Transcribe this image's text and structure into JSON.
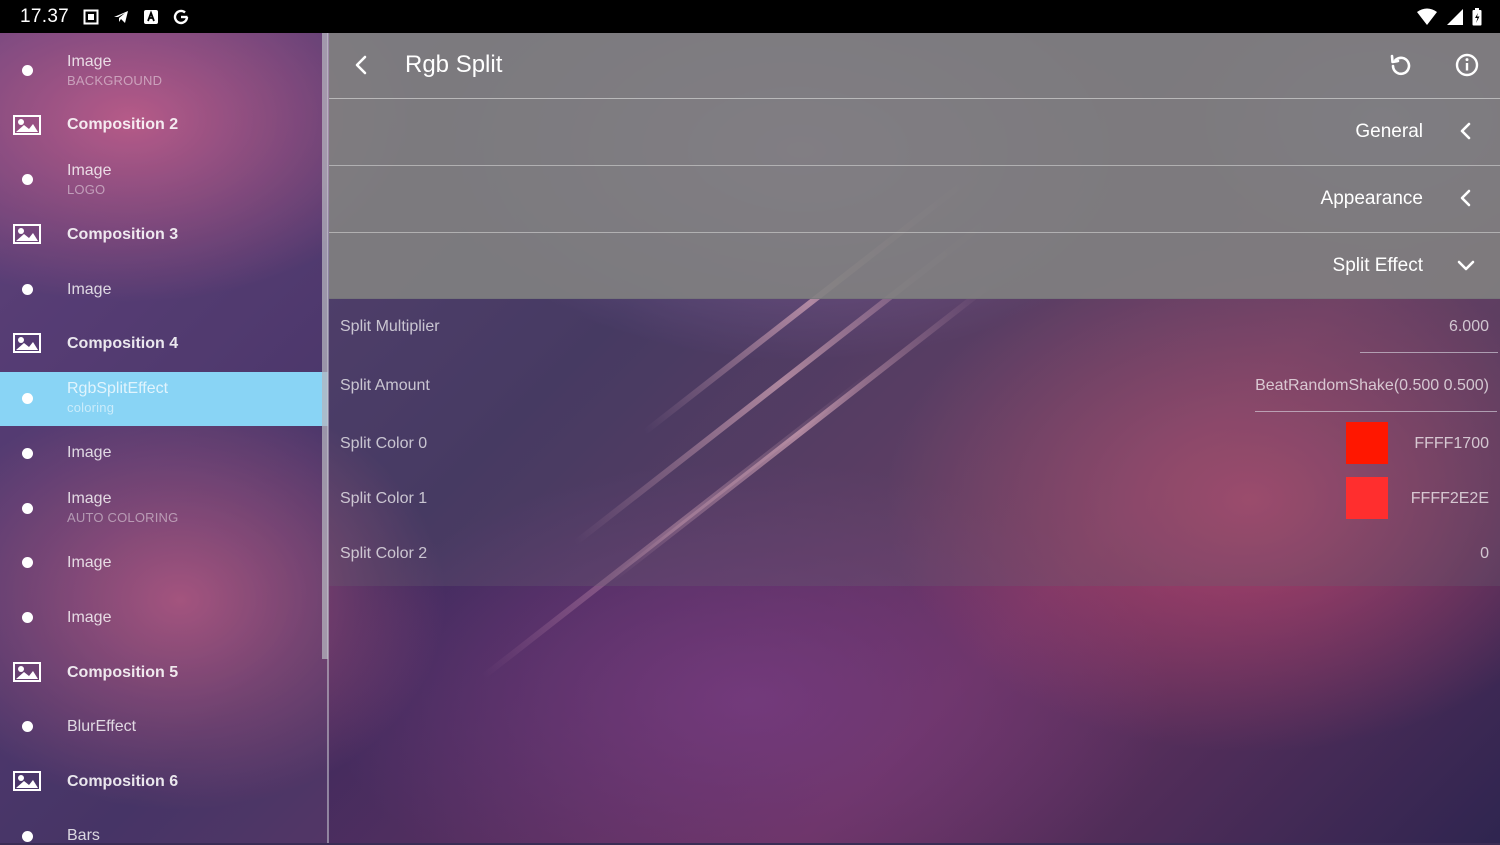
{
  "status_bar": {
    "time": "17.37",
    "left_icons": [
      "screenshot-icon",
      "telegram-icon",
      "a-badge-icon",
      "google-icon"
    ],
    "right_icons": [
      "wifi-icon",
      "signal-icon",
      "battery-icon"
    ]
  },
  "sidebar": {
    "items": [
      {
        "type": "layer",
        "title": "Image",
        "subtitle": "BACKGROUND"
      },
      {
        "type": "composition",
        "title": "Composition 2",
        "subtitle": ""
      },
      {
        "type": "layer",
        "title": "Image",
        "subtitle": "LOGO"
      },
      {
        "type": "composition",
        "title": "Composition 3",
        "subtitle": ""
      },
      {
        "type": "layer",
        "title": "Image",
        "subtitle": ""
      },
      {
        "type": "composition",
        "title": "Composition 4",
        "subtitle": ""
      },
      {
        "type": "layer",
        "title": "RgbSplitEffect",
        "subtitle": "coloring",
        "selected": true
      },
      {
        "type": "layer",
        "title": "Image",
        "subtitle": ""
      },
      {
        "type": "layer",
        "title": "Image",
        "subtitle": "AUTO COLORING"
      },
      {
        "type": "layer",
        "title": "Image",
        "subtitle": ""
      },
      {
        "type": "layer",
        "title": "Image",
        "subtitle": ""
      },
      {
        "type": "composition",
        "title": "Composition 5",
        "subtitle": ""
      },
      {
        "type": "layer",
        "title": "BlurEffect",
        "subtitle": ""
      },
      {
        "type": "composition",
        "title": "Composition 6",
        "subtitle": ""
      },
      {
        "type": "layer",
        "title": "Bars",
        "subtitle": ""
      }
    ],
    "selected_color": "#89d4f5"
  },
  "toolbar": {
    "title": "Rgb Split",
    "back_icon": "chevron-left-icon",
    "refresh_icon": "refresh-icon",
    "info_icon": "info-icon"
  },
  "sections": {
    "general": {
      "label": "General",
      "state": "collapsed"
    },
    "appearance": {
      "label": "Appearance",
      "state": "collapsed"
    },
    "split_effect": {
      "label": "Split Effect",
      "state": "expanded"
    }
  },
  "properties": {
    "split_multiplier": {
      "label": "Split Multiplier",
      "value": "6.000"
    },
    "split_amount": {
      "label": "Split Amount",
      "value": "BeatRandomShake(0.500 0.500)"
    },
    "split_color_0": {
      "label": "Split Color 0",
      "value": "FFFF1700",
      "swatch": "#ff1700"
    },
    "split_color_1": {
      "label": "Split Color 1",
      "value": "FFFF2E2E",
      "swatch": "#ff2e2e"
    },
    "split_color_2": {
      "label": "Split Color 2",
      "value": "0"
    }
  }
}
